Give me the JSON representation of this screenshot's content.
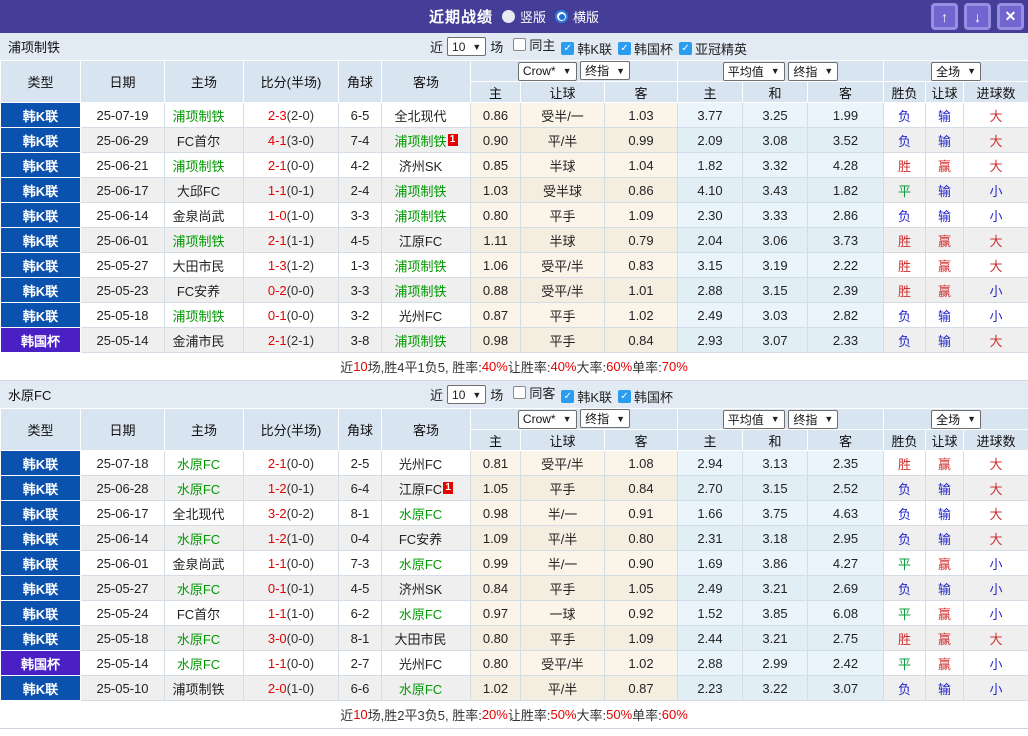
{
  "titlebar": {
    "title": "近期战绩",
    "radio_vertical": "竖版",
    "radio_horizontal": "横版",
    "buttons": {
      "up": "↑",
      "down": "↓",
      "close": "✕"
    }
  },
  "table_header": {
    "col_type": "类型",
    "col_date": "日期",
    "col_home": "主场",
    "col_score": "比分(半场)",
    "col_corner": "角球",
    "col_away": "客场",
    "dd_source": "Crow*",
    "dd_final": "终指",
    "dd_avg": "平均值",
    "dd_final2": "终指",
    "dd_full": "全场",
    "sub_home": "主",
    "sub_handicap": "让球",
    "sub_away": "客",
    "sub_avg_home": "主",
    "sub_avg_draw": "和",
    "sub_avg_away": "客",
    "sub_result": "胜负",
    "sub_handicap2": "让球",
    "sub_goals": "进球数"
  },
  "colors": {
    "titlebar": "#453e99",
    "league_blue": "#0b52ae",
    "cup_purple": "#4a20c4",
    "self_team_green": "#009900",
    "score_red": "#e60000",
    "win_red": "#d03030",
    "lose_blue": "#2525cc",
    "draw_green": "#0a9a3c",
    "handicap_odds_bg": "#fbf5e9",
    "average_odds_bg": "#e9f5fb",
    "checkbox_blue": "#2b9df0"
  },
  "sections": [
    {
      "team": "浦项制铁",
      "filter": {
        "near_label": "近",
        "count": "10",
        "unit_label": "场",
        "checkboxes": [
          {
            "label": "同主",
            "checked": false
          },
          {
            "label": "韩K联",
            "checked": true
          },
          {
            "label": "韩国杯",
            "checked": true
          },
          {
            "label": "亚冠精英",
            "checked": true
          }
        ]
      },
      "rows": [
        {
          "league": "韩K联",
          "cup": false,
          "date": "25-07-19",
          "home": "浦项制铁",
          "home_self": true,
          "home_badge": "",
          "score": "2-3",
          "half": "(2-0)",
          "corner": "6-5",
          "away": "全北现代",
          "away_self": false,
          "away_badge": "",
          "h1": "0.86",
          "hc": "受半/一",
          "h2": "1.03",
          "m1": "3.77",
          "m2": "3.25",
          "m3": "1.99",
          "r1": "负",
          "r1c": "blue",
          "r2": "输",
          "r2c": "blue",
          "r3": "大",
          "r3c": "red"
        },
        {
          "league": "韩K联",
          "cup": false,
          "date": "25-06-29",
          "home": "FC首尔",
          "home_self": false,
          "home_badge": "",
          "score": "4-1",
          "half": "(3-0)",
          "corner": "7-4",
          "away": "浦项制铁",
          "away_self": true,
          "away_badge": "1",
          "h1": "0.90",
          "hc": "平/半",
          "h2": "0.99",
          "m1": "2.09",
          "m2": "3.08",
          "m3": "3.52",
          "r1": "负",
          "r1c": "blue",
          "r2": "输",
          "r2c": "blue",
          "r3": "大",
          "r3c": "red"
        },
        {
          "league": "韩K联",
          "cup": false,
          "date": "25-06-21",
          "home": "浦项制铁",
          "home_self": true,
          "home_badge": "",
          "score": "2-1",
          "half": "(0-0)",
          "corner": "4-2",
          "away": "济州SK",
          "away_self": false,
          "away_badge": "",
          "h1": "0.85",
          "hc": "半球",
          "h2": "1.04",
          "m1": "1.82",
          "m2": "3.32",
          "m3": "4.28",
          "r1": "胜",
          "r1c": "red",
          "r2": "赢",
          "r2c": "red",
          "r3": "大",
          "r3c": "red"
        },
        {
          "league": "韩K联",
          "cup": false,
          "date": "25-06-17",
          "home": "大邱FC",
          "home_self": false,
          "home_badge": "",
          "score": "1-1",
          "half": "(0-1)",
          "corner": "2-4",
          "away": "浦项制铁",
          "away_self": true,
          "away_badge": "",
          "h1": "1.03",
          "hc": "受半球",
          "h2": "0.86",
          "m1": "4.10",
          "m2": "3.43",
          "m3": "1.82",
          "r1": "平",
          "r1c": "green",
          "r2": "输",
          "r2c": "blue",
          "r3": "小",
          "r3c": "blue"
        },
        {
          "league": "韩K联",
          "cup": false,
          "date": "25-06-14",
          "home": "金泉尚武",
          "home_self": false,
          "home_badge": "",
          "score": "1-0",
          "half": "(1-0)",
          "corner": "3-3",
          "away": "浦项制铁",
          "away_self": true,
          "away_badge": "",
          "h1": "0.80",
          "hc": "平手",
          "h2": "1.09",
          "m1": "2.30",
          "m2": "3.33",
          "m3": "2.86",
          "r1": "负",
          "r1c": "blue",
          "r2": "输",
          "r2c": "blue",
          "r3": "小",
          "r3c": "blue"
        },
        {
          "league": "韩K联",
          "cup": false,
          "date": "25-06-01",
          "home": "浦项制铁",
          "home_self": true,
          "home_badge": "",
          "score": "2-1",
          "half": "(1-1)",
          "corner": "4-5",
          "away": "江原FC",
          "away_self": false,
          "away_badge": "",
          "h1": "1.11",
          "hc": "半球",
          "h2": "0.79",
          "m1": "2.04",
          "m2": "3.06",
          "m3": "3.73",
          "r1": "胜",
          "r1c": "red",
          "r2": "赢",
          "r2c": "red",
          "r3": "大",
          "r3c": "red"
        },
        {
          "league": "韩K联",
          "cup": false,
          "date": "25-05-27",
          "home": "大田市民",
          "home_self": false,
          "home_badge": "",
          "score": "1-3",
          "half": "(1-2)",
          "corner": "1-3",
          "away": "浦项制铁",
          "away_self": true,
          "away_badge": "",
          "h1": "1.06",
          "hc": "受平/半",
          "h2": "0.83",
          "m1": "3.15",
          "m2": "3.19",
          "m3": "2.22",
          "r1": "胜",
          "r1c": "red",
          "r2": "赢",
          "r2c": "red",
          "r3": "大",
          "r3c": "red"
        },
        {
          "league": "韩K联",
          "cup": false,
          "date": "25-05-23",
          "home": "FC安养",
          "home_self": false,
          "home_badge": "",
          "score": "0-2",
          "half": "(0-0)",
          "corner": "3-3",
          "away": "浦项制铁",
          "away_self": true,
          "away_badge": "",
          "h1": "0.88",
          "hc": "受平/半",
          "h2": "1.01",
          "m1": "2.88",
          "m2": "3.15",
          "m3": "2.39",
          "r1": "胜",
          "r1c": "red",
          "r2": "赢",
          "r2c": "red",
          "r3": "小",
          "r3c": "blue"
        },
        {
          "league": "韩K联",
          "cup": false,
          "date": "25-05-18",
          "home": "浦项制铁",
          "home_self": true,
          "home_badge": "",
          "score": "0-1",
          "half": "(0-0)",
          "corner": "3-2",
          "away": "光州FC",
          "away_self": false,
          "away_badge": "",
          "h1": "0.87",
          "hc": "平手",
          "h2": "1.02",
          "m1": "2.49",
          "m2": "3.03",
          "m3": "2.82",
          "r1": "负",
          "r1c": "blue",
          "r2": "输",
          "r2c": "blue",
          "r3": "小",
          "r3c": "blue"
        },
        {
          "league": "韩国杯",
          "cup": true,
          "date": "25-05-14",
          "home": "金浦市民",
          "home_self": false,
          "home_badge": "",
          "score": "2-1",
          "half": "(2-1)",
          "corner": "3-8",
          "away": "浦项制铁",
          "away_self": true,
          "away_badge": "",
          "h1": "0.98",
          "hc": "平手",
          "h2": "0.84",
          "m1": "2.93",
          "m2": "3.07",
          "m3": "2.33",
          "r1": "负",
          "r1c": "blue",
          "r2": "输",
          "r2c": "blue",
          "r3": "大",
          "r3c": "red"
        }
      ],
      "summary": [
        {
          "t": "近"
        },
        {
          "t": "10",
          "red": true
        },
        {
          "t": "场,胜4平1负5, 胜率:"
        },
        {
          "t": "40%",
          "red": true
        },
        {
          "t": " 让胜率:"
        },
        {
          "t": "40%",
          "red": true
        },
        {
          "t": " 大率:"
        },
        {
          "t": "60%",
          "red": true
        },
        {
          "t": " 单率:"
        },
        {
          "t": "70%",
          "red": true
        }
      ]
    },
    {
      "team": "水原FC",
      "filter": {
        "near_label": "近",
        "count": "10",
        "unit_label": "场",
        "checkboxes": [
          {
            "label": "同客",
            "checked": false
          },
          {
            "label": "韩K联",
            "checked": true
          },
          {
            "label": "韩国杯",
            "checked": true
          }
        ]
      },
      "rows": [
        {
          "league": "韩K联",
          "cup": false,
          "date": "25-07-18",
          "home": "水原FC",
          "home_self": true,
          "home_badge": "",
          "score": "2-1",
          "half": "(0-0)",
          "corner": "2-5",
          "away": "光州FC",
          "away_self": false,
          "away_badge": "",
          "h1": "0.81",
          "hc": "受平/半",
          "h2": "1.08",
          "m1": "2.94",
          "m2": "3.13",
          "m3": "2.35",
          "r1": "胜",
          "r1c": "red",
          "r2": "赢",
          "r2c": "red",
          "r3": "大",
          "r3c": "red"
        },
        {
          "league": "韩K联",
          "cup": false,
          "date": "25-06-28",
          "home": "水原FC",
          "home_self": true,
          "home_badge": "",
          "score": "1-2",
          "half": "(0-1)",
          "corner": "6-4",
          "away": "江原FC",
          "away_self": false,
          "away_badge": "1",
          "h1": "1.05",
          "hc": "平手",
          "h2": "0.84",
          "m1": "2.70",
          "m2": "3.15",
          "m3": "2.52",
          "r1": "负",
          "r1c": "blue",
          "r2": "输",
          "r2c": "blue",
          "r3": "大",
          "r3c": "red"
        },
        {
          "league": "韩K联",
          "cup": false,
          "date": "25-06-17",
          "home": "全北现代",
          "home_self": false,
          "home_badge": "",
          "score": "3-2",
          "half": "(0-2)",
          "corner": "8-1",
          "away": "水原FC",
          "away_self": true,
          "away_badge": "",
          "h1": "0.98",
          "hc": "半/一",
          "h2": "0.91",
          "m1": "1.66",
          "m2": "3.75",
          "m3": "4.63",
          "r1": "负",
          "r1c": "blue",
          "r2": "输",
          "r2c": "blue",
          "r3": "大",
          "r3c": "red"
        },
        {
          "league": "韩K联",
          "cup": false,
          "date": "25-06-14",
          "home": "水原FC",
          "home_self": true,
          "home_badge": "",
          "score": "1-2",
          "half": "(1-0)",
          "corner": "0-4",
          "away": "FC安养",
          "away_self": false,
          "away_badge": "",
          "h1": "1.09",
          "hc": "平/半",
          "h2": "0.80",
          "m1": "2.31",
          "m2": "3.18",
          "m3": "2.95",
          "r1": "负",
          "r1c": "blue",
          "r2": "输",
          "r2c": "blue",
          "r3": "大",
          "r3c": "red"
        },
        {
          "league": "韩K联",
          "cup": false,
          "date": "25-06-01",
          "home": "金泉尚武",
          "home_self": false,
          "home_badge": "",
          "score": "1-1",
          "half": "(0-0)",
          "corner": "7-3",
          "away": "水原FC",
          "away_self": true,
          "away_badge": "",
          "h1": "0.99",
          "hc": "半/一",
          "h2": "0.90",
          "m1": "1.69",
          "m2": "3.86",
          "m3": "4.27",
          "r1": "平",
          "r1c": "green",
          "r2": "赢",
          "r2c": "red",
          "r3": "小",
          "r3c": "blue"
        },
        {
          "league": "韩K联",
          "cup": false,
          "date": "25-05-27",
          "home": "水原FC",
          "home_self": true,
          "home_badge": "",
          "score": "0-1",
          "half": "(0-1)",
          "corner": "4-5",
          "away": "济州SK",
          "away_self": false,
          "away_badge": "",
          "h1": "0.84",
          "hc": "平手",
          "h2": "1.05",
          "m1": "2.49",
          "m2": "3.21",
          "m3": "2.69",
          "r1": "负",
          "r1c": "blue",
          "r2": "输",
          "r2c": "blue",
          "r3": "小",
          "r3c": "blue"
        },
        {
          "league": "韩K联",
          "cup": false,
          "date": "25-05-24",
          "home": "FC首尔",
          "home_self": false,
          "home_badge": "",
          "score": "1-1",
          "half": "(1-0)",
          "corner": "6-2",
          "away": "水原FC",
          "away_self": true,
          "away_badge": "",
          "h1": "0.97",
          "hc": "一球",
          "h2": "0.92",
          "m1": "1.52",
          "m2": "3.85",
          "m3": "6.08",
          "r1": "平",
          "r1c": "green",
          "r2": "赢",
          "r2c": "red",
          "r3": "小",
          "r3c": "blue"
        },
        {
          "league": "韩K联",
          "cup": false,
          "date": "25-05-18",
          "home": "水原FC",
          "home_self": true,
          "home_badge": "",
          "score": "3-0",
          "half": "(0-0)",
          "corner": "8-1",
          "away": "大田市民",
          "away_self": false,
          "away_badge": "",
          "h1": "0.80",
          "hc": "平手",
          "h2": "1.09",
          "m1": "2.44",
          "m2": "3.21",
          "m3": "2.75",
          "r1": "胜",
          "r1c": "red",
          "r2": "赢",
          "r2c": "red",
          "r3": "大",
          "r3c": "red"
        },
        {
          "league": "韩国杯",
          "cup": true,
          "date": "25-05-14",
          "home": "水原FC",
          "home_self": true,
          "home_badge": "",
          "score": "1-1",
          "half": "(0-0)",
          "corner": "2-7",
          "away": "光州FC",
          "away_self": false,
          "away_badge": "",
          "h1": "0.80",
          "hc": "受平/半",
          "h2": "1.02",
          "m1": "2.88",
          "m2": "2.99",
          "m3": "2.42",
          "r1": "平",
          "r1c": "green",
          "r2": "赢",
          "r2c": "red",
          "r3": "小",
          "r3c": "blue"
        },
        {
          "league": "韩K联",
          "cup": false,
          "date": "25-05-10",
          "home": "浦项制铁",
          "home_self": false,
          "home_badge": "",
          "score": "2-0",
          "half": "(1-0)",
          "corner": "6-6",
          "away": "水原FC",
          "away_self": true,
          "away_badge": "",
          "h1": "1.02",
          "hc": "平/半",
          "h2": "0.87",
          "m1": "2.23",
          "m2": "3.22",
          "m3": "3.07",
          "r1": "负",
          "r1c": "blue",
          "r2": "输",
          "r2c": "blue",
          "r3": "小",
          "r3c": "blue"
        }
      ],
      "summary": [
        {
          "t": "近"
        },
        {
          "t": "10",
          "red": true
        },
        {
          "t": "场,胜2平3负5, 胜率:"
        },
        {
          "t": "20%",
          "red": true
        },
        {
          "t": " 让胜率:"
        },
        {
          "t": "50%",
          "red": true
        },
        {
          "t": " 大率:"
        },
        {
          "t": "50%",
          "red": true
        },
        {
          "t": " 单率:"
        },
        {
          "t": "60%",
          "red": true
        }
      ]
    }
  ]
}
